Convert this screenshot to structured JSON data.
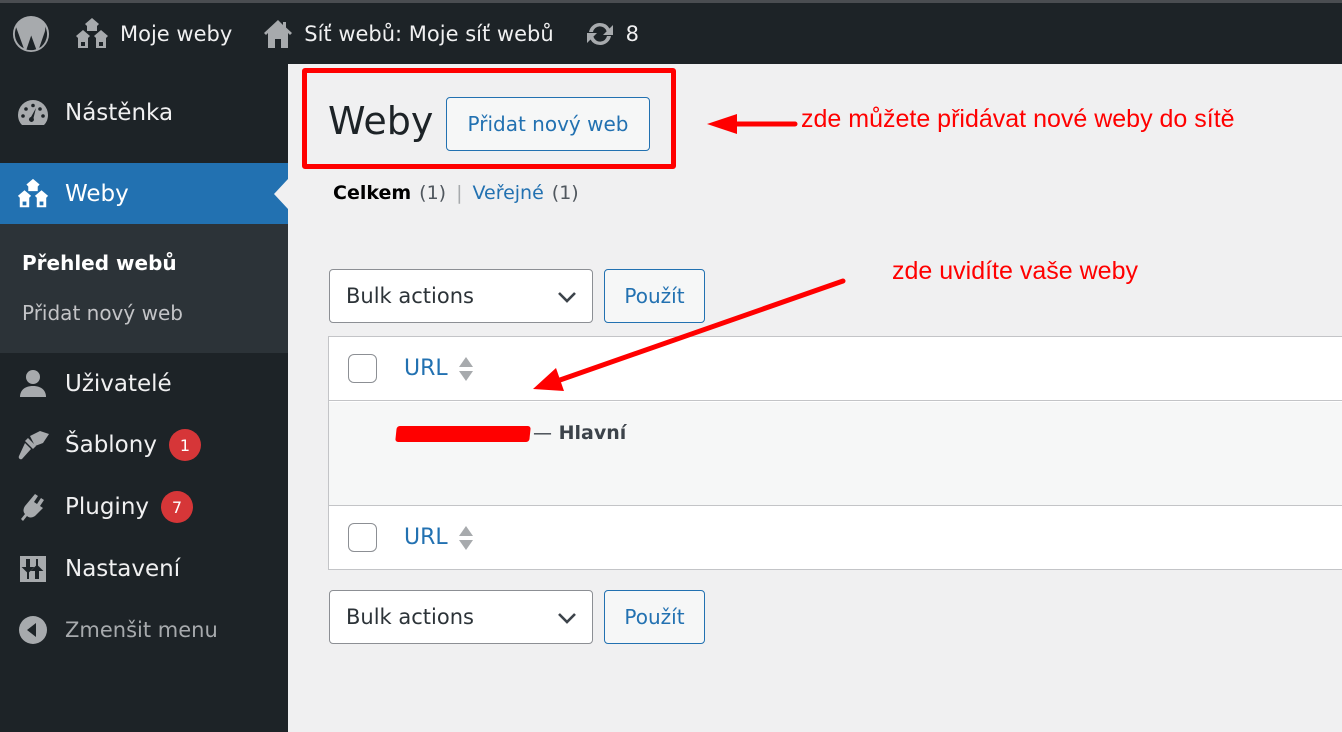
{
  "adminbar": {
    "my_sites": "Moje weby",
    "network": "Síť webů: Moje síť webů",
    "updates_count": "8"
  },
  "sidebar": {
    "items": [
      {
        "label": "Nástěnka",
        "icon": "dashboard-icon"
      },
      {
        "label": "Weby",
        "icon": "sites-icon",
        "active": true
      },
      {
        "label": "Uživatelé",
        "icon": "users-icon"
      },
      {
        "label": "Šablony",
        "icon": "themes-icon",
        "badge": "1"
      },
      {
        "label": "Pluginy",
        "icon": "plugins-icon",
        "badge": "7"
      },
      {
        "label": "Nastavení",
        "icon": "settings-icon"
      }
    ],
    "submenu": [
      {
        "label": "Přehled webů",
        "current": true
      },
      {
        "label": "Přidat nový web"
      }
    ],
    "collapse_label": "Zmenšit menu"
  },
  "main": {
    "title": "Weby",
    "add_new_label": "Přidat nový web",
    "filters": {
      "all_label": "Celkem",
      "all_count": "(1)",
      "separator": "|",
      "public_label": "Veřejné",
      "public_count": "(1)"
    },
    "bulk_actions": {
      "selected": "Bulk actions",
      "apply_label": "Použít"
    },
    "table": {
      "column_header": "URL",
      "rows": [
        {
          "url": "[redacted]",
          "suffix_dash": "—",
          "suffix": "Hlavní"
        }
      ]
    }
  },
  "annotations": {
    "add_note": "zde můžete přidávat nové weby do sítě",
    "list_note": "zde uvidíte vaše weby",
    "color": "#ff0000"
  },
  "colors": {
    "accent": "#2271b1",
    "sidebar_bg": "#1d2327",
    "submenu_bg": "#2c3338",
    "badge": "#d63638"
  }
}
